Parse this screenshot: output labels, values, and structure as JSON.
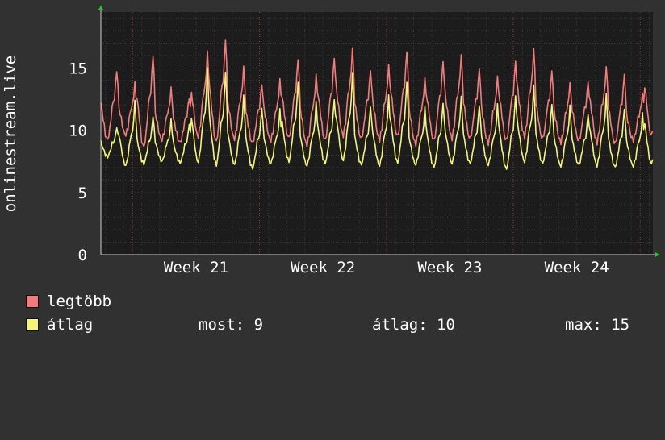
{
  "chart": {
    "ylabel": "onlinestream.live",
    "background_color": "#313131",
    "plot_color": "#1c1c1c",
    "grid_color": "#555555",
    "axis_arrow_color": "#22cc22",
    "week_line_color": "#8c3a3a"
  },
  "legend": {
    "items": [
      {
        "label": "legtöbb",
        "color": "#f47b7b"
      },
      {
        "label": "átlag",
        "color": "#f5f57a"
      }
    ],
    "stats": {
      "most": "most: 9",
      "atlag": "átlag: 10",
      "max": "max: 15"
    }
  },
  "chart_data": {
    "type": "line",
    "title": "",
    "xlabel": "",
    "ylabel": "onlinestream.live",
    "ylim": [
      0,
      19.5
    ],
    "xlim": [
      20.25,
      24.6
    ],
    "yticks": [
      0,
      5,
      10,
      15
    ],
    "xticks": [
      {
        "value": 21,
        "label": "Week 21"
      },
      {
        "value": 22,
        "label": "Week 22"
      },
      {
        "value": 23,
        "label": "Week 23"
      },
      {
        "value": 24,
        "label": "Week 24"
      }
    ],
    "grid": true,
    "daily_shape": {
      "comment_free": true,
      "phase_hours": [
        0,
        3,
        6,
        9,
        12,
        15,
        18,
        20,
        21,
        22,
        24
      ],
      "legtobb_level": [
        0.55,
        0.35,
        0.12,
        0.05,
        0.2,
        0.5,
        0.62,
        0.85,
        1.0,
        0.85,
        0.55
      ],
      "atlag_level": [
        0.5,
        0.3,
        0.1,
        0.02,
        0.18,
        0.45,
        0.55,
        0.8,
        1.0,
        0.8,
        0.5
      ]
    },
    "series": [
      {
        "name": "legtöbb",
        "color": "#f47b7b",
        "daily_min": [
          8.9,
          9.4,
          8.2,
          9.0,
          8.8,
          9.1,
          8.6,
          9.0,
          8.7,
          8.9,
          9.0,
          8.5,
          8.8,
          9.2,
          9.0,
          8.9,
          9.1,
          8.6,
          8.8,
          9.0,
          9.0,
          8.7,
          8.8,
          9.1,
          9.0,
          8.8,
          8.9,
          8.7,
          8.6,
          9.0,
          9.1
        ],
        "daily_max": [
          14.9,
          13.7,
          16.1,
          13.3,
          12.7,
          16.2,
          17.4,
          15.0,
          13.8,
          14.0,
          15.8,
          14.4,
          15.9,
          16.5,
          14.9,
          15.2,
          16.4,
          14.2,
          15.6,
          16.0,
          15.0,
          14.3,
          15.6,
          16.5,
          14.8,
          13.8,
          13.9,
          15.1,
          14.5,
          13.0,
          17.3
        ]
      },
      {
        "name": "átlag",
        "color": "#f5f57a",
        "daily_min": [
          7.8,
          7.0,
          7.2,
          7.4,
          7.3,
          7.2,
          7.0,
          7.1,
          6.8,
          7.2,
          7.3,
          7.0,
          7.2,
          7.4,
          7.1,
          7.0,
          7.2,
          7.1,
          6.9,
          7.2,
          7.2,
          7.1,
          6.7,
          7.3,
          7.2,
          7.0,
          7.1,
          7.0,
          6.9,
          7.0,
          7.1
        ],
        "daily_max": [
          10.3,
          12.3,
          11.2,
          10.8,
          10.6,
          14.9,
          14.8,
          12.7,
          11.9,
          11.6,
          14.0,
          12.2,
          12.6,
          14.5,
          12.0,
          12.7,
          14.0,
          11.8,
          12.3,
          12.6,
          12.1,
          12.0,
          12.9,
          13.5,
          12.2,
          11.9,
          11.4,
          12.8,
          11.8,
          11.3,
          14.0
        ]
      }
    ],
    "start_week": 20.25,
    "days": 31
  }
}
